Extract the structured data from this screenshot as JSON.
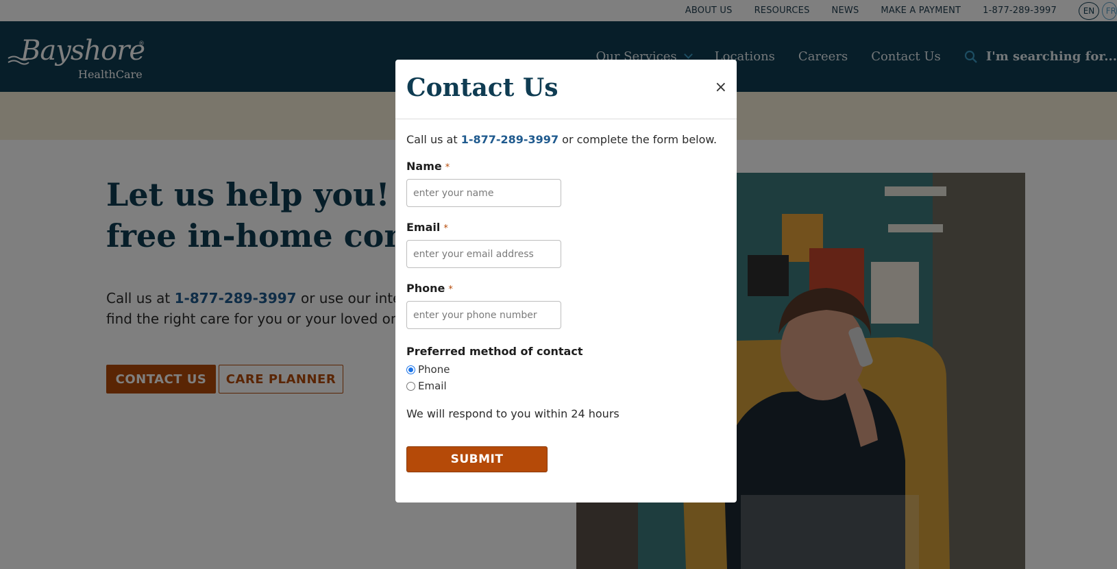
{
  "utility": {
    "links": [
      "ABOUT US",
      "RESOURCES",
      "NEWS",
      "MAKE A PAYMENT",
      "1-877-289-3997"
    ],
    "lang_en": "EN",
    "lang_fr": "FR"
  },
  "header": {
    "logo_word": "Bayshore",
    "logo_reg": "®",
    "logo_sub": "HealthCare",
    "nav": [
      "Our Services",
      "Locations",
      "Careers",
      "Contact Us"
    ],
    "search_label": "I'm searching for..."
  },
  "hero": {
    "heading": "Let us help you! We offer a free in-home consultation.",
    "text_before": "Call us at ",
    "phone": "1-877-289-3997",
    "text_after": " or use our interactive care planner to find the right care for you or your loved one.",
    "contact_button": "CONTACT US",
    "planner_button": "CARE PLANNER"
  },
  "modal": {
    "title": "Contact Us",
    "close": "×",
    "intro_before": "Call us at ",
    "intro_phone": "1-877-289-3997",
    "intro_after": " or complete the form below.",
    "fields": [
      {
        "label": "Name",
        "placeholder": "enter your name"
      },
      {
        "label": "Email",
        "placeholder": "enter your email address"
      },
      {
        "label": "Phone",
        "placeholder": "enter your phone number"
      }
    ],
    "required_mark": "*",
    "preferred_label": "Preferred method of contact",
    "options": [
      {
        "label": "Phone",
        "checked": true
      },
      {
        "label": "Email",
        "checked": false
      }
    ],
    "respond_text": "We will respond to you within 24 hours",
    "submit": "SUBMIT"
  },
  "colors": {
    "navy": "#0f3c52",
    "accent_orange": "#b54a08",
    "link_blue": "#1f5a8e",
    "cream": "#f5edd7"
  }
}
